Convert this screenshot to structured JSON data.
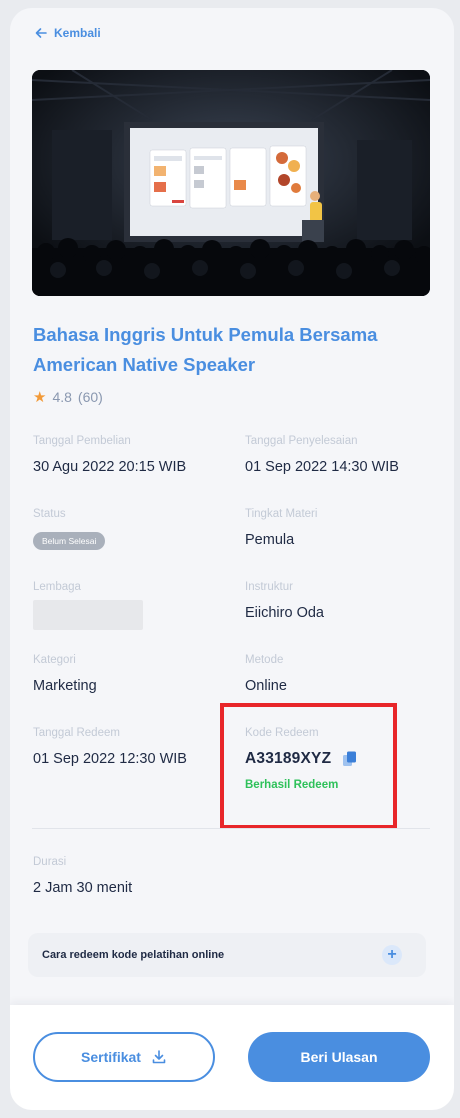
{
  "nav": {
    "back_label": "Kembali"
  },
  "course": {
    "title": "Bahasa Inggris Untuk Pemula Bersama American Native Speaker",
    "rating": "4.8",
    "review_count": "(60)"
  },
  "details": {
    "purchase_date": {
      "label": "Tanggal Pembelian",
      "value": "30 Agu 2022 20:15 WIB"
    },
    "completion_date": {
      "label": "Tanggal Penyelesaian",
      "value": "01 Sep 2022 14:30 WIB"
    },
    "status": {
      "label": "Status",
      "value": "Belum Selesai"
    },
    "level": {
      "label": "Tingkat Materi",
      "value": "Pemula"
    },
    "institution": {
      "label": "Lembaga"
    },
    "instructor": {
      "label": "Instruktur",
      "value": "Eiichiro Oda"
    },
    "category": {
      "label": "Kategori",
      "value": "Marketing"
    },
    "method": {
      "label": "Metode",
      "value": "Online"
    },
    "redeem_date": {
      "label": "Tanggal Redeem",
      "value": "01 Sep 2022 12:30 WIB"
    },
    "redeem_code": {
      "label": "Kode Redeem",
      "value": "A33189XYZ",
      "status": "Berhasil Redeem"
    },
    "duration": {
      "label": "Durasi",
      "value": "2 Jam 30 menit"
    }
  },
  "accordion": {
    "label": "Cara redeem kode pelatihan online",
    "icon": "plus-icon"
  },
  "footer": {
    "certificate_label": "Sertifikat",
    "review_label": "Beri Ulasan"
  },
  "colors": {
    "accent": "#4a8ee0",
    "success": "#2ec15a",
    "highlight": "#e8262a",
    "star": "#f29a38"
  }
}
